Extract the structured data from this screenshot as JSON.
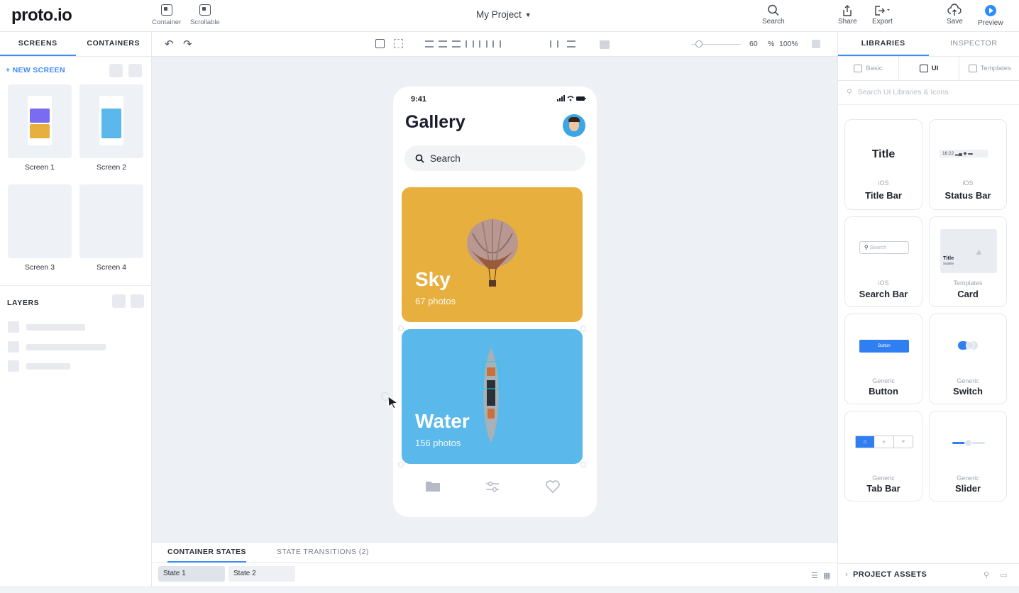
{
  "app": {
    "logo": "proto.io",
    "project_title": "My Project"
  },
  "toolbar": {
    "container_label": "Container",
    "scrollable_label": "Scrollable",
    "search_label": "Search",
    "share_label": "Share",
    "export_label": "Export",
    "save_label": "Save",
    "preview_label": "Preview"
  },
  "left_panel": {
    "tabs": [
      {
        "label": "SCREENS",
        "active": true
      },
      {
        "label": "CONTAINERS",
        "active": false
      }
    ],
    "new_screen": "+ NEW SCREEN",
    "screens": [
      {
        "label": "Screen 1"
      },
      {
        "label": "Screen 2"
      },
      {
        "label": "Screen 3"
      },
      {
        "label": "Screen 4"
      }
    ],
    "layers_title": "LAYERS"
  },
  "canvas_toolbar": {
    "zoom_value": "60",
    "zoom_unit": "%",
    "zoom_reset": "100%"
  },
  "phone": {
    "time": "9:41",
    "status_icons": "signal-wifi-battery",
    "title": "Gallery",
    "search_placeholder": "Search",
    "cards": [
      {
        "title": "Sky",
        "subtitle": "67 photos",
        "color": "#e7b03e",
        "image": "hot-air-balloon"
      },
      {
        "title": "Water",
        "subtitle": "156 photos",
        "color": "#5ab8ea",
        "image": "boat"
      }
    ],
    "nav": [
      "folder-icon",
      "sliders-icon",
      "heart-icon"
    ]
  },
  "states_panel": {
    "tabs": [
      {
        "label": "CONTAINER STATES",
        "active": true
      },
      {
        "label": "STATE TRANSITIONS (2)",
        "active": false
      }
    ],
    "states": [
      {
        "label": "State 1",
        "selected": true
      },
      {
        "label": "State 2",
        "selected": false
      }
    ]
  },
  "right_panel": {
    "tabs": [
      {
        "label": "LIBRARIES",
        "active": true
      },
      {
        "label": "INSPECTOR",
        "active": false
      }
    ],
    "subtabs": [
      {
        "label": "Basic"
      },
      {
        "label": "UI",
        "active": true
      },
      {
        "label": "Templates"
      }
    ],
    "search_placeholder": "Search UI Libraries & Icons",
    "items": [
      {
        "category": "iOS",
        "name": "Title Bar",
        "preview_text": "Title"
      },
      {
        "category": "iOS",
        "name": "Status Bar",
        "preview_text": "16:22"
      },
      {
        "category": "iOS",
        "name": "Search Bar",
        "preview_text": "Search"
      },
      {
        "category": "Templates",
        "name": "Card",
        "preview_text": "Title",
        "preview_sub": "Subtitle"
      },
      {
        "category": "Generic",
        "name": "Button",
        "preview_text": "Button"
      },
      {
        "category": "Generic",
        "name": "Switch"
      },
      {
        "category": "Generic",
        "name": "Tab Bar"
      },
      {
        "category": "Generic",
        "name": "Slider"
      }
    ],
    "project_assets": "PROJECT ASSETS"
  },
  "colors": {
    "accent": "#3d8cff",
    "canvas_bg": "#edf0f5",
    "sky": "#e7b03e",
    "water": "#5ab8ea"
  }
}
